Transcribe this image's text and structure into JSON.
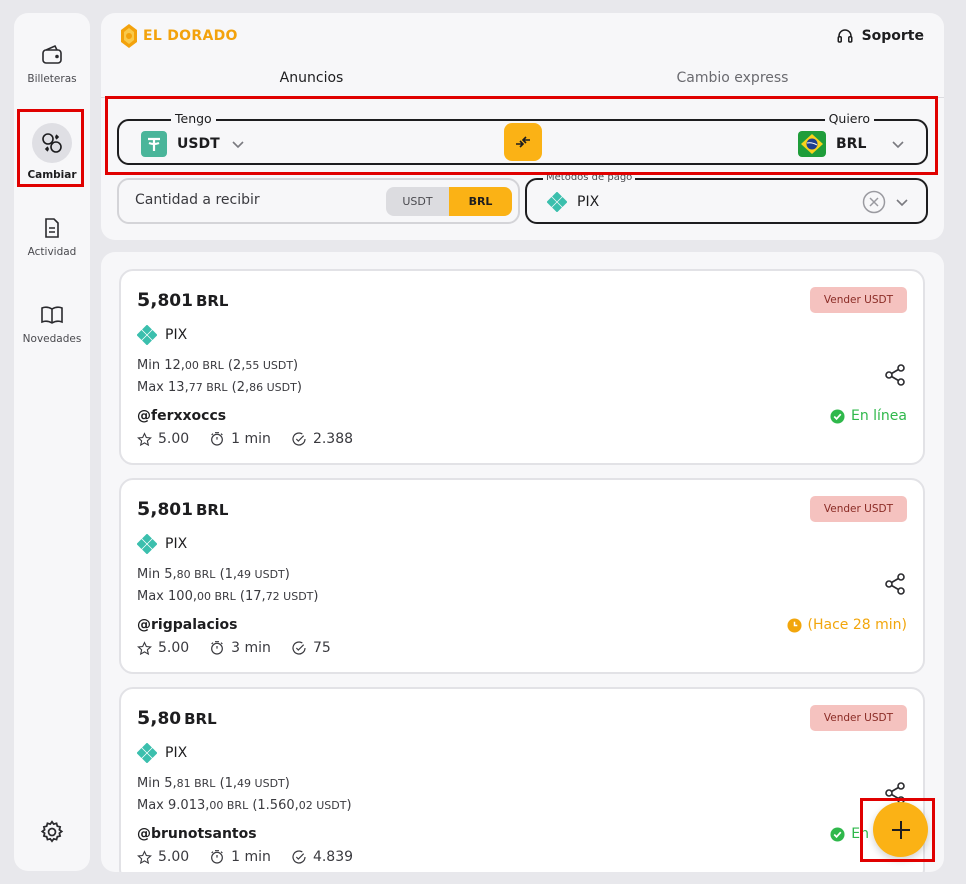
{
  "brand": {
    "name": "EL DORADO",
    "accent": "#fbb215"
  },
  "header": {
    "support_label": "Soporte"
  },
  "sidebar": {
    "items": [
      {
        "label": "Billeteras",
        "icon": "wallet-icon"
      },
      {
        "label": "Cambiar",
        "icon": "exchange-icon",
        "active": true
      },
      {
        "label": "Actividad",
        "icon": "document-icon"
      },
      {
        "label": "Novedades",
        "icon": "book-icon"
      }
    ],
    "settings_icon": "gear-icon"
  },
  "tabs": [
    {
      "label": "Anuncios",
      "active": true
    },
    {
      "label": "Cambio express",
      "active": false
    }
  ],
  "exchange": {
    "have_label": "Tengo",
    "have_currency": "USDT",
    "want_label": "Quiero",
    "want_currency": "BRL"
  },
  "amount": {
    "placeholder": "Cantidad a recibir",
    "toggle_off": "USDT",
    "toggle_on": "BRL"
  },
  "payment_method": {
    "label": "Métodos de pago",
    "value": "PIX"
  },
  "offers": [
    {
      "price_int": "5,",
      "price_dec": "801",
      "currency": "BRL",
      "badge": "Vender USDT",
      "method": "PIX",
      "min_label": "Min",
      "min_main": "12,",
      "min_dec": "00 BRL",
      "min_paren_open": " (2,",
      "min_alt_dec": "55 USDT",
      "min_paren_close": ")",
      "max_label": "Max",
      "max_main": "13,",
      "max_dec": "77 BRL",
      "max_paren_open": " (2,",
      "max_alt_dec": "86 USDT",
      "max_paren_close": ")",
      "user": "@ferxxoccs",
      "status": "En línea",
      "status_type": "online",
      "rating": "5.00",
      "time": "1 min",
      "trades": "2.388"
    },
    {
      "price_int": "5,",
      "price_dec": "801",
      "currency": "BRL",
      "badge": "Vender USDT",
      "method": "PIX",
      "min_label": "Min",
      "min_main": "5,",
      "min_dec": "80 BRL",
      "min_paren_open": " (1,",
      "min_alt_dec": "49 USDT",
      "min_paren_close": ")",
      "max_label": "Max",
      "max_main": "100,",
      "max_dec": "00 BRL",
      "max_paren_open": " (17,",
      "max_alt_dec": "72 USDT",
      "max_paren_close": ")",
      "user": "@rigpalacios",
      "status": "(Hace 28 min)",
      "status_type": "away",
      "rating": "5.00",
      "time": "3 min",
      "trades": "75"
    },
    {
      "price_int": "5,",
      "price_dec": "80",
      "currency": "BRL",
      "badge": "Vender USDT",
      "method": "PIX",
      "min_label": "Min",
      "min_main": "5,",
      "min_dec": "81 BRL",
      "min_paren_open": " (1,",
      "min_alt_dec": "49 USDT",
      "min_paren_close": ")",
      "max_label": "Max",
      "max_main": "9.013,",
      "max_dec": "00 BRL",
      "max_paren_open": " (1.560,",
      "max_alt_dec": "02 USDT",
      "max_paren_close": ")",
      "user": "@brunotsantos",
      "status": "En",
      "status_type": "online",
      "rating": "5.00",
      "time": "1 min",
      "trades": "4.839"
    }
  ]
}
